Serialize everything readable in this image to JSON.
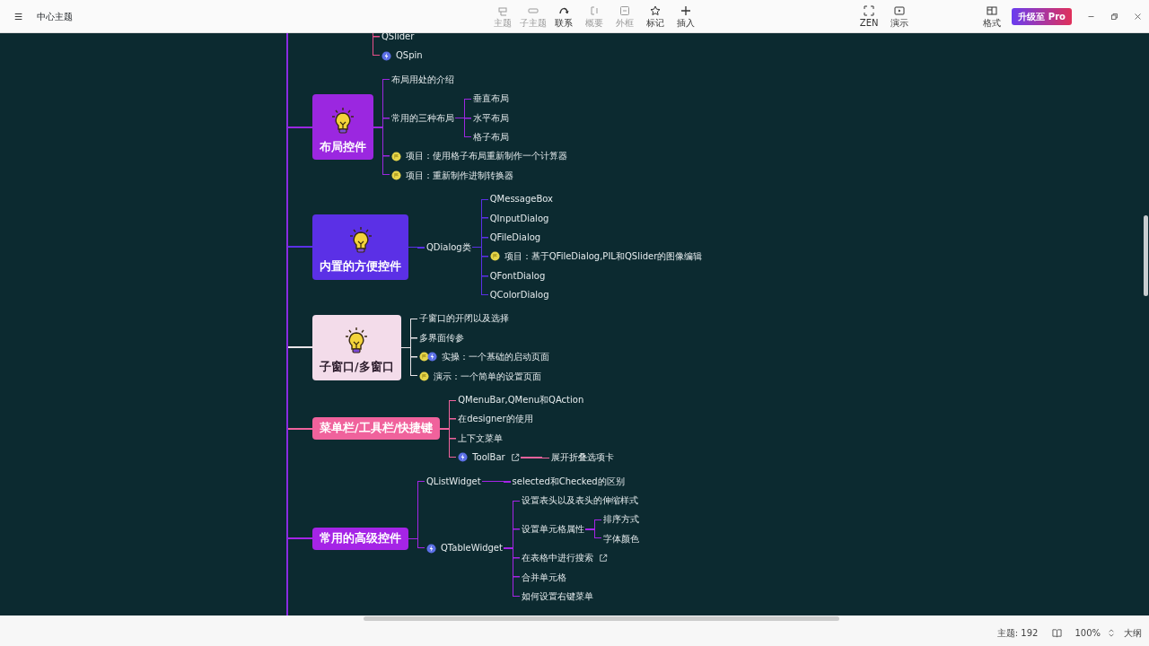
{
  "window": {
    "title": "中心主题"
  },
  "toolbar": [
    {
      "label": "主题",
      "kind": "topic",
      "disabled": true
    },
    {
      "label": "子主题",
      "kind": "subtopic",
      "disabled": true
    },
    {
      "label": "联系",
      "kind": "relation",
      "disabled": false
    },
    {
      "label": "概要",
      "kind": "summary",
      "disabled": true
    },
    {
      "label": "外框",
      "kind": "boundary",
      "disabled": true
    },
    {
      "label": "标记",
      "kind": "marker",
      "disabled": false
    },
    {
      "label": "插入",
      "kind": "insert",
      "disabled": false
    }
  ],
  "view_buttons": [
    {
      "label": "ZEN",
      "kind": "zen"
    },
    {
      "label": "演示",
      "kind": "present"
    }
  ],
  "format_button": {
    "label": "格式"
  },
  "upgrade_button": {
    "label": "升级至 Pro"
  },
  "mind_map": {
    "cut_group": [
      {
        "label": "QSlider"
      },
      {
        "label": "QSpin",
        "kind": "flash"
      }
    ],
    "branches": [
      {
        "label": "布局控件",
        "kind": "illustrated",
        "color": "#9b27e0",
        "children": [
          {
            "label": "布局用处的介绍"
          },
          {
            "label": "常用的三种布局",
            "children": [
              {
                "label": "垂直布局"
              },
              {
                "label": "水平布局"
              },
              {
                "label": "格子布局"
              }
            ]
          },
          {
            "label": "项目：使用格子布局重新制作一个计算器",
            "kind": "task"
          },
          {
            "label": "项目：重新制作进制转换器",
            "kind": "task"
          }
        ]
      },
      {
        "label": "内置的方便控件",
        "kind": "illustrated",
        "color": "#5b30e6",
        "children": [
          {
            "label": "QDialog类",
            "children": [
              {
                "label": "QMessageBox"
              },
              {
                "label": "QInputDialog"
              },
              {
                "label": "QFileDialog"
              },
              {
                "label": "项目：基于QFileDialog,PIL和QSlider的图像编辑",
                "kind": "task"
              },
              {
                "label": "QFontDialog"
              },
              {
                "label": "QColorDialog"
              }
            ]
          }
        ]
      },
      {
        "label": "子窗口/多窗口",
        "kind": "illustrated",
        "color": "#f3dcea",
        "children": [
          {
            "label": "子窗口的开闭以及选择"
          },
          {
            "label": "多界面传参"
          },
          {
            "label": "实操：一个基础的启动页面",
            "kind": "task-flash"
          },
          {
            "label": "演示：一个简单的设置页面",
            "kind": "task"
          }
        ]
      },
      {
        "label": "菜单栏/工具栏/快捷键",
        "kind": "plain",
        "color": "#f0629c",
        "children": [
          {
            "label": "QMenuBar,QMenu和QAction"
          },
          {
            "label": "在designer的使用"
          },
          {
            "label": "上下文菜单"
          },
          {
            "label": "ToolBar",
            "kind": "flash",
            "linked": true,
            "children": [
              {
                "label": "展开折叠选项卡"
              }
            ]
          }
        ]
      },
      {
        "label": "常用的高级控件",
        "kind": "plain",
        "color": "#a524e6",
        "children": [
          {
            "label": "QListWidget",
            "children": [
              {
                "label": "selected和Checked的区别"
              }
            ]
          },
          {
            "label": "QTableWidget",
            "kind": "flash",
            "children": [
              {
                "label": "设置表头以及表头的伸缩样式"
              },
              {
                "label": "设置单元格属性",
                "children": [
                  {
                    "label": "排序方式"
                  },
                  {
                    "label": "字体颜色"
                  }
                ]
              },
              {
                "label": "在表格中进行搜索",
                "linked": true
              },
              {
                "label": "合并单元格"
              },
              {
                "label": "如何设置右键菜单"
              }
            ]
          }
        ]
      }
    ]
  },
  "status_bar": {
    "topic_count": "主题: 192",
    "zoom": "100%",
    "outline": "大纲"
  }
}
